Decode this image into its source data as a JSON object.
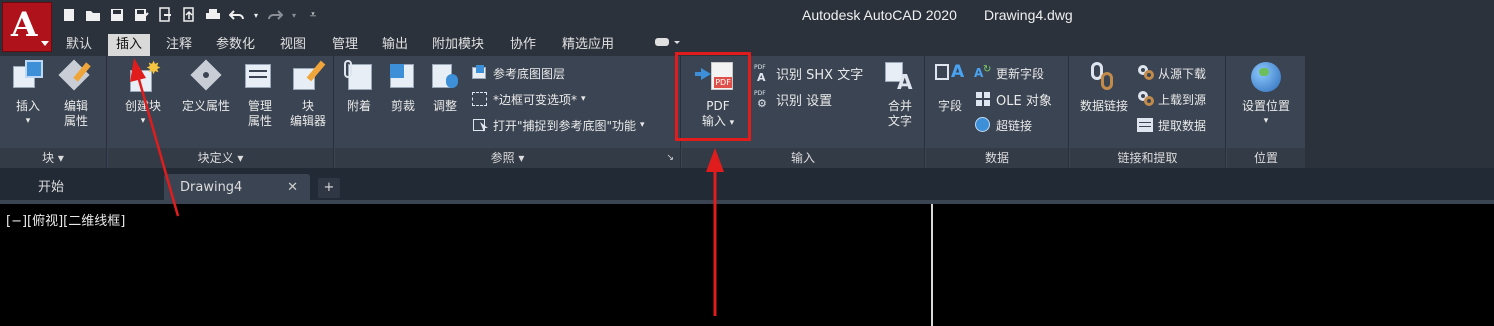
{
  "titlebar": {
    "app_button_letter": "A",
    "app_title": "Autodesk AutoCAD 2020",
    "doc_title": "Drawing4.dwg",
    "qat_icons": [
      "new-icon",
      "open-icon",
      "save-icon",
      "save-as-icon",
      "open-from-web-icon",
      "save-to-web-icon",
      "plot-icon",
      "undo-icon",
      "redo-icon",
      "customize-icon"
    ]
  },
  "ribbon_tabs": [
    {
      "label": "默认"
    },
    {
      "label": "插入",
      "active": true
    },
    {
      "label": "注释"
    },
    {
      "label": "参数化"
    },
    {
      "label": "视图"
    },
    {
      "label": "管理"
    },
    {
      "label": "输出"
    },
    {
      "label": "附加模块"
    },
    {
      "label": "协作"
    },
    {
      "label": "精选应用"
    }
  ],
  "panels": {
    "block": {
      "title": "块",
      "insert": "插入",
      "edit_attr_1": "编辑",
      "edit_attr_2": "属性"
    },
    "block_definition": {
      "title": "块定义",
      "create_block": "创建块",
      "define_attr": "定义属性",
      "manage_attr_1": "管理",
      "manage_attr_2": "属性",
      "block_editor_1": "块",
      "block_editor_2": "编辑器"
    },
    "reference": {
      "title": "参照",
      "attach": "附着",
      "clip": "剪裁",
      "adjust": "调整",
      "underlay_layers": "参考底图图层",
      "frames_vary": "*边框可变选项*",
      "snap_underlay": "打开\"捕捉到参考底图\"功能"
    },
    "import": {
      "title": "输入",
      "pdf_import_1": "PDF",
      "pdf_import_2": "输入",
      "recognize_shx": "识别 SHX 文字",
      "recognize_settings": "识别 设置",
      "combine_text_1": "合并",
      "combine_text_2": "文字"
    },
    "data": {
      "title": "数据",
      "field": "字段",
      "update_fields": "更新字段",
      "ole_object": "OLE 对象",
      "hyperlink": "超链接"
    },
    "linking": {
      "title": "链接和提取",
      "data_link": "数据链接",
      "download_from_source": "从源下载",
      "upload_to_source": "上载到源",
      "extract_data": "提取数据"
    },
    "location": {
      "title": "位置",
      "set_location": "设置位置"
    }
  },
  "file_tabs": {
    "start": "开始",
    "drawing": "Drawing4",
    "close": "✕",
    "add": "+"
  },
  "canvas": {
    "viewport_label": "[−][俯视][二维线框]"
  },
  "colors": {
    "annotation_red": "#e01c1c",
    "ribbon_bg": "#3b4452",
    "titlebar_bg": "#2b323c"
  }
}
